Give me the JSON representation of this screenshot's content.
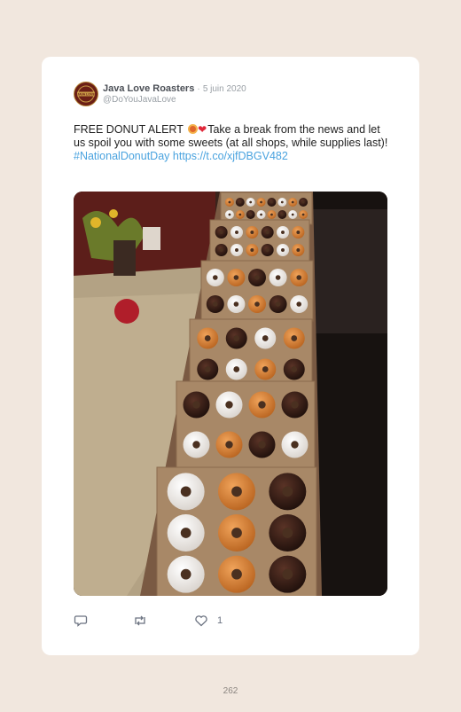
{
  "tweet": {
    "display_name": "Java Love Roasters",
    "separator": "·",
    "date": "5 juin 2020",
    "handle": "@DoYouJavaLove",
    "text_part1": "FREE DONUT ALERT ",
    "text_part2": "Take a break from the news and let us spoil you with some sweets (at all shops, while supplies last)!",
    "hashtag": "#NationalDonutDay",
    "link": "https://t.co/xjfDBGV482",
    "emoji_icons": [
      "donut-emoji",
      "heart-emoji"
    ],
    "avatar_text": "JAVA LOVE",
    "image_alt": "Boxes of assorted donuts on a table next to coffee sacks"
  },
  "actions": {
    "reply_icon": "reply-icon",
    "retweet_icon": "retweet-icon",
    "like_icon": "heart-icon",
    "like_count": "1"
  },
  "page_number": "262"
}
